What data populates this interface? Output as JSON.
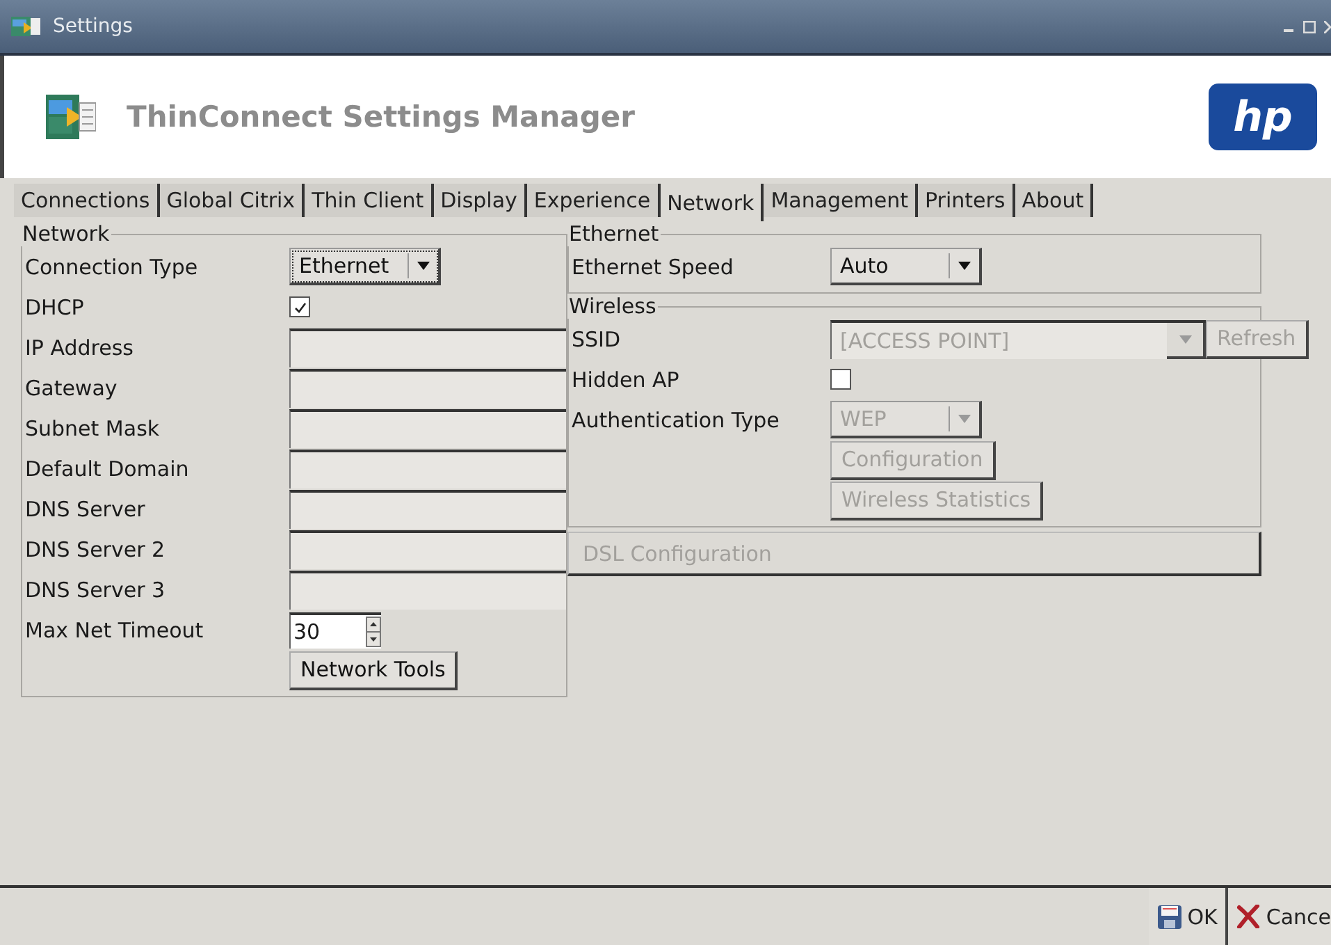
{
  "window": {
    "title": "Settings"
  },
  "header": {
    "title": "ThinConnect Settings Manager",
    "logo_text": "hp"
  },
  "tabs": [
    {
      "label": "Connections",
      "selected": false
    },
    {
      "label": "Global Citrix",
      "selected": false
    },
    {
      "label": "Thin Client",
      "selected": false
    },
    {
      "label": "Display",
      "selected": false
    },
    {
      "label": "Experience",
      "selected": false
    },
    {
      "label": "Network",
      "selected": true
    },
    {
      "label": "Management",
      "selected": false
    },
    {
      "label": "Printers",
      "selected": false
    },
    {
      "label": "About",
      "selected": false
    }
  ],
  "network_group": {
    "title": "Network",
    "rows": [
      {
        "label": "Connection Type",
        "kind": "dropdown",
        "value": "Ethernet",
        "disabled": false
      },
      {
        "label": "DHCP",
        "kind": "checkbox",
        "checked": true
      },
      {
        "label": "IP Address",
        "kind": "text"
      },
      {
        "label": "Gateway",
        "kind": "text"
      },
      {
        "label": "Subnet Mask",
        "kind": "text"
      },
      {
        "label": "Default Domain",
        "kind": "text"
      },
      {
        "label": "DNS Server",
        "kind": "text"
      },
      {
        "label": "DNS Server 2",
        "kind": "text"
      },
      {
        "label": "DNS Server 3",
        "kind": "text"
      },
      {
        "label": "Max Net Timeout",
        "kind": "spinner",
        "value": "30"
      }
    ],
    "button": "Network Tools"
  },
  "ethernet_group": {
    "title": "Ethernet",
    "rows": [
      {
        "label": "Ethernet Speed",
        "kind": "dropdown",
        "value": "Auto",
        "disabled": false
      }
    ]
  },
  "wireless_group": {
    "title": "Wireless",
    "rows": [
      {
        "label": "SSID",
        "kind": "combo",
        "value": "[ACCESS POINT]",
        "button": "Refresh",
        "disabled": true
      },
      {
        "label": "Hidden AP",
        "kind": "checkbox",
        "checked": false
      },
      {
        "label": "Authentication Type",
        "kind": "dropdown",
        "value": "WEP",
        "disabled": true
      }
    ],
    "buttons": [
      {
        "label": "Configuration",
        "disabled": true
      },
      {
        "label": "Wireless Statistics",
        "disabled": true
      }
    ]
  },
  "dsl_button": {
    "label": "DSL Configuration",
    "disabled": true
  },
  "footer_buttons": [
    {
      "label": "OK",
      "kind": "save"
    },
    {
      "label": "Cance",
      "kind": "cancel"
    }
  ]
}
